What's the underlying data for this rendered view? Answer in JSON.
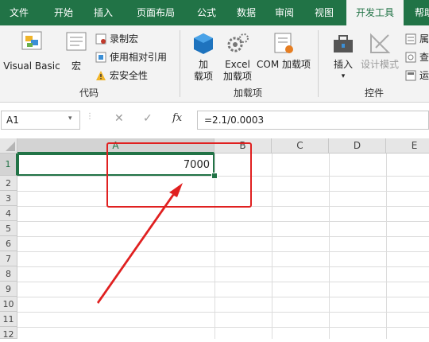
{
  "tabs": [
    "文件",
    "开始",
    "插入",
    "页面布局",
    "公式",
    "数据",
    "审阅",
    "视图",
    "开发工具",
    "帮助"
  ],
  "active_tab": "开发工具",
  "ribbon": {
    "code_group": {
      "label": "代码",
      "visual_basic": "Visual Basic",
      "macro": "宏",
      "record_macro": "录制宏",
      "relative_ref": "使用相对引用",
      "macro_security": "宏安全性"
    },
    "addins_group": {
      "label": "加载项",
      "addins_1": "加",
      "addins_2": "载项",
      "excel_addins_1": "Excel",
      "excel_addins_2": "加载项",
      "com_addins": "COM 加载项"
    },
    "controls_group": {
      "label": "控件",
      "insert": "插入",
      "design_mode": "设计模式",
      "properties": "属",
      "view_code": "查",
      "run_dialog": "运"
    }
  },
  "formula_bar": {
    "name_box": "A1",
    "cancel": "✕",
    "enter": "✓",
    "fx": "fx",
    "formula": "=2.1/0.0003"
  },
  "sheet": {
    "columns": [
      "A",
      "B",
      "C",
      "D",
      "E"
    ],
    "rows": [
      "1",
      "2",
      "3",
      "4",
      "5",
      "6",
      "7",
      "8",
      "9",
      "10",
      "11",
      "12"
    ],
    "cell_a1": "7000"
  },
  "colors": {
    "ribbon_green": "#217346",
    "annotation_red": "#e02020"
  }
}
